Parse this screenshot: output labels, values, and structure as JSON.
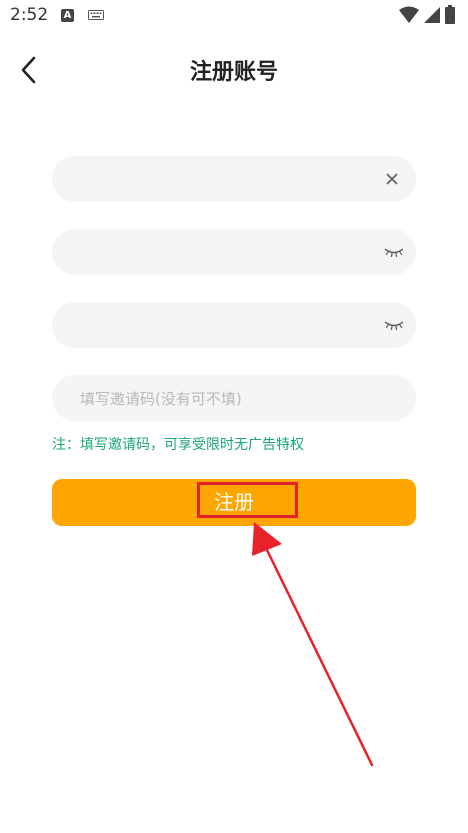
{
  "status_bar": {
    "time": "2:52",
    "keyboard_letter": "A",
    "icons": [
      "keyboard-icon",
      "wifi-icon",
      "signal-icon",
      "battery-icon"
    ]
  },
  "header": {
    "title": "注册账号",
    "back_icon": "chevron-left-icon"
  },
  "form": {
    "account_field": {
      "value": "",
      "placeholder": "",
      "trailing_icon": "close-icon"
    },
    "password_field": {
      "value": "",
      "placeholder": "",
      "trailing_icon": "eye-closed-icon"
    },
    "confirm_password_field": {
      "value": "",
      "placeholder": "",
      "trailing_icon": "eye-closed-icon"
    },
    "invite_code_field": {
      "value": "",
      "placeholder": "填写邀请码(没有可不填)"
    },
    "note": "注：填写邀请码，可享受限时无广告特权",
    "register_label": "注册"
  },
  "colors": {
    "accent": "#FFA500",
    "note_text": "#1aa57a",
    "field_bg": "#f5f5f5",
    "annotation": "#e8222a"
  }
}
